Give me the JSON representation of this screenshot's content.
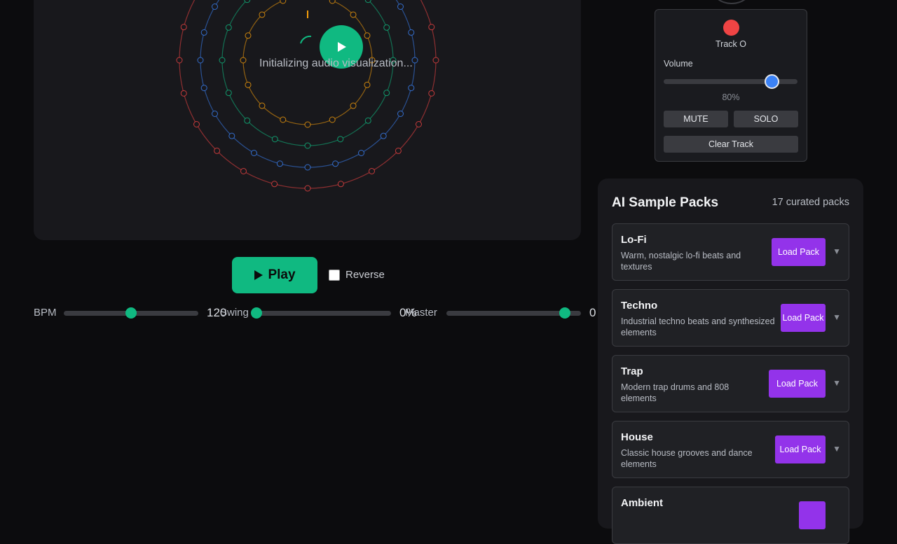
{
  "visualizer": {
    "status": "Initializing audio visualization...",
    "ring_colors": [
      "#f59e0b",
      "#10b981",
      "#3b82f6",
      "#ef4444"
    ]
  },
  "transport": {
    "play_label": "Play",
    "reverse_label": "Reverse",
    "reverse_checked": false
  },
  "sliders": [
    {
      "label": "BPM",
      "value": "120",
      "fraction": 0.5
    },
    {
      "label": "Swing",
      "value": "0%",
      "fraction": 0.0
    },
    {
      "label": "Master",
      "value": "0",
      "fraction": 0.88
    }
  ],
  "track": {
    "name": "Track O",
    "color": "#ef4444",
    "volume_label": "Volume",
    "volume_value": "80%",
    "volume_fraction": 0.8,
    "mute_label": "MUTE",
    "solo_label": "SOLO",
    "clear_label": "Clear Track"
  },
  "packs": {
    "title": "AI Sample Packs",
    "count": "17 curated packs",
    "load_label": "Load Pack",
    "items": [
      {
        "name": "Lo-Fi",
        "description": "Warm, nostalgic lo-fi beats and textures"
      },
      {
        "name": "Techno",
        "description": "Industrial techno beats and synthesized elements"
      },
      {
        "name": "Trap",
        "description": "Modern trap drums and 808 elements"
      },
      {
        "name": "House",
        "description": "Classic house grooves and dance elements"
      },
      {
        "name": "Ambient",
        "description": ""
      }
    ]
  },
  "colors": {
    "accent_green": "#10b981",
    "accent_purple": "#9333ea",
    "accent_blue": "#3b82f6"
  }
}
